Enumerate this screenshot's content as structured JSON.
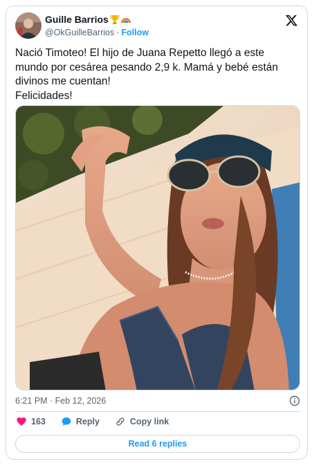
{
  "user": {
    "display_name": "Guille Barrios",
    "handle": "@OkGuilleBarrios",
    "separator": "·",
    "follow_label": "Follow",
    "name_emojis": [
      "trophy-icon",
      "rainbow-icon"
    ]
  },
  "tweet": {
    "lines": [
      "Nació Timoteo! El hijo de Juana Repetto llegó a este mundo por cesárea pesando 2,9 k. Mamá y bebé están divinos me cuentan!",
      "Felicidades!"
    ],
    "timestamp": "6:21 PM · Feb 12, 2026"
  },
  "actions": {
    "like_count": "163",
    "reply_label": "Reply",
    "copy_link_label": "Copy link",
    "read_replies_label": "Read 6 replies"
  },
  "colors": {
    "text": "#0f1419",
    "secondary": "#536471",
    "accent": "#1d9bf0",
    "like": "#f91880",
    "border": "#cfd9de"
  },
  "icons": {
    "brand": "x-logo-icon",
    "info": "info-icon",
    "like": "heart-icon",
    "reply": "reply-bubble-icon",
    "copy": "link-icon"
  }
}
